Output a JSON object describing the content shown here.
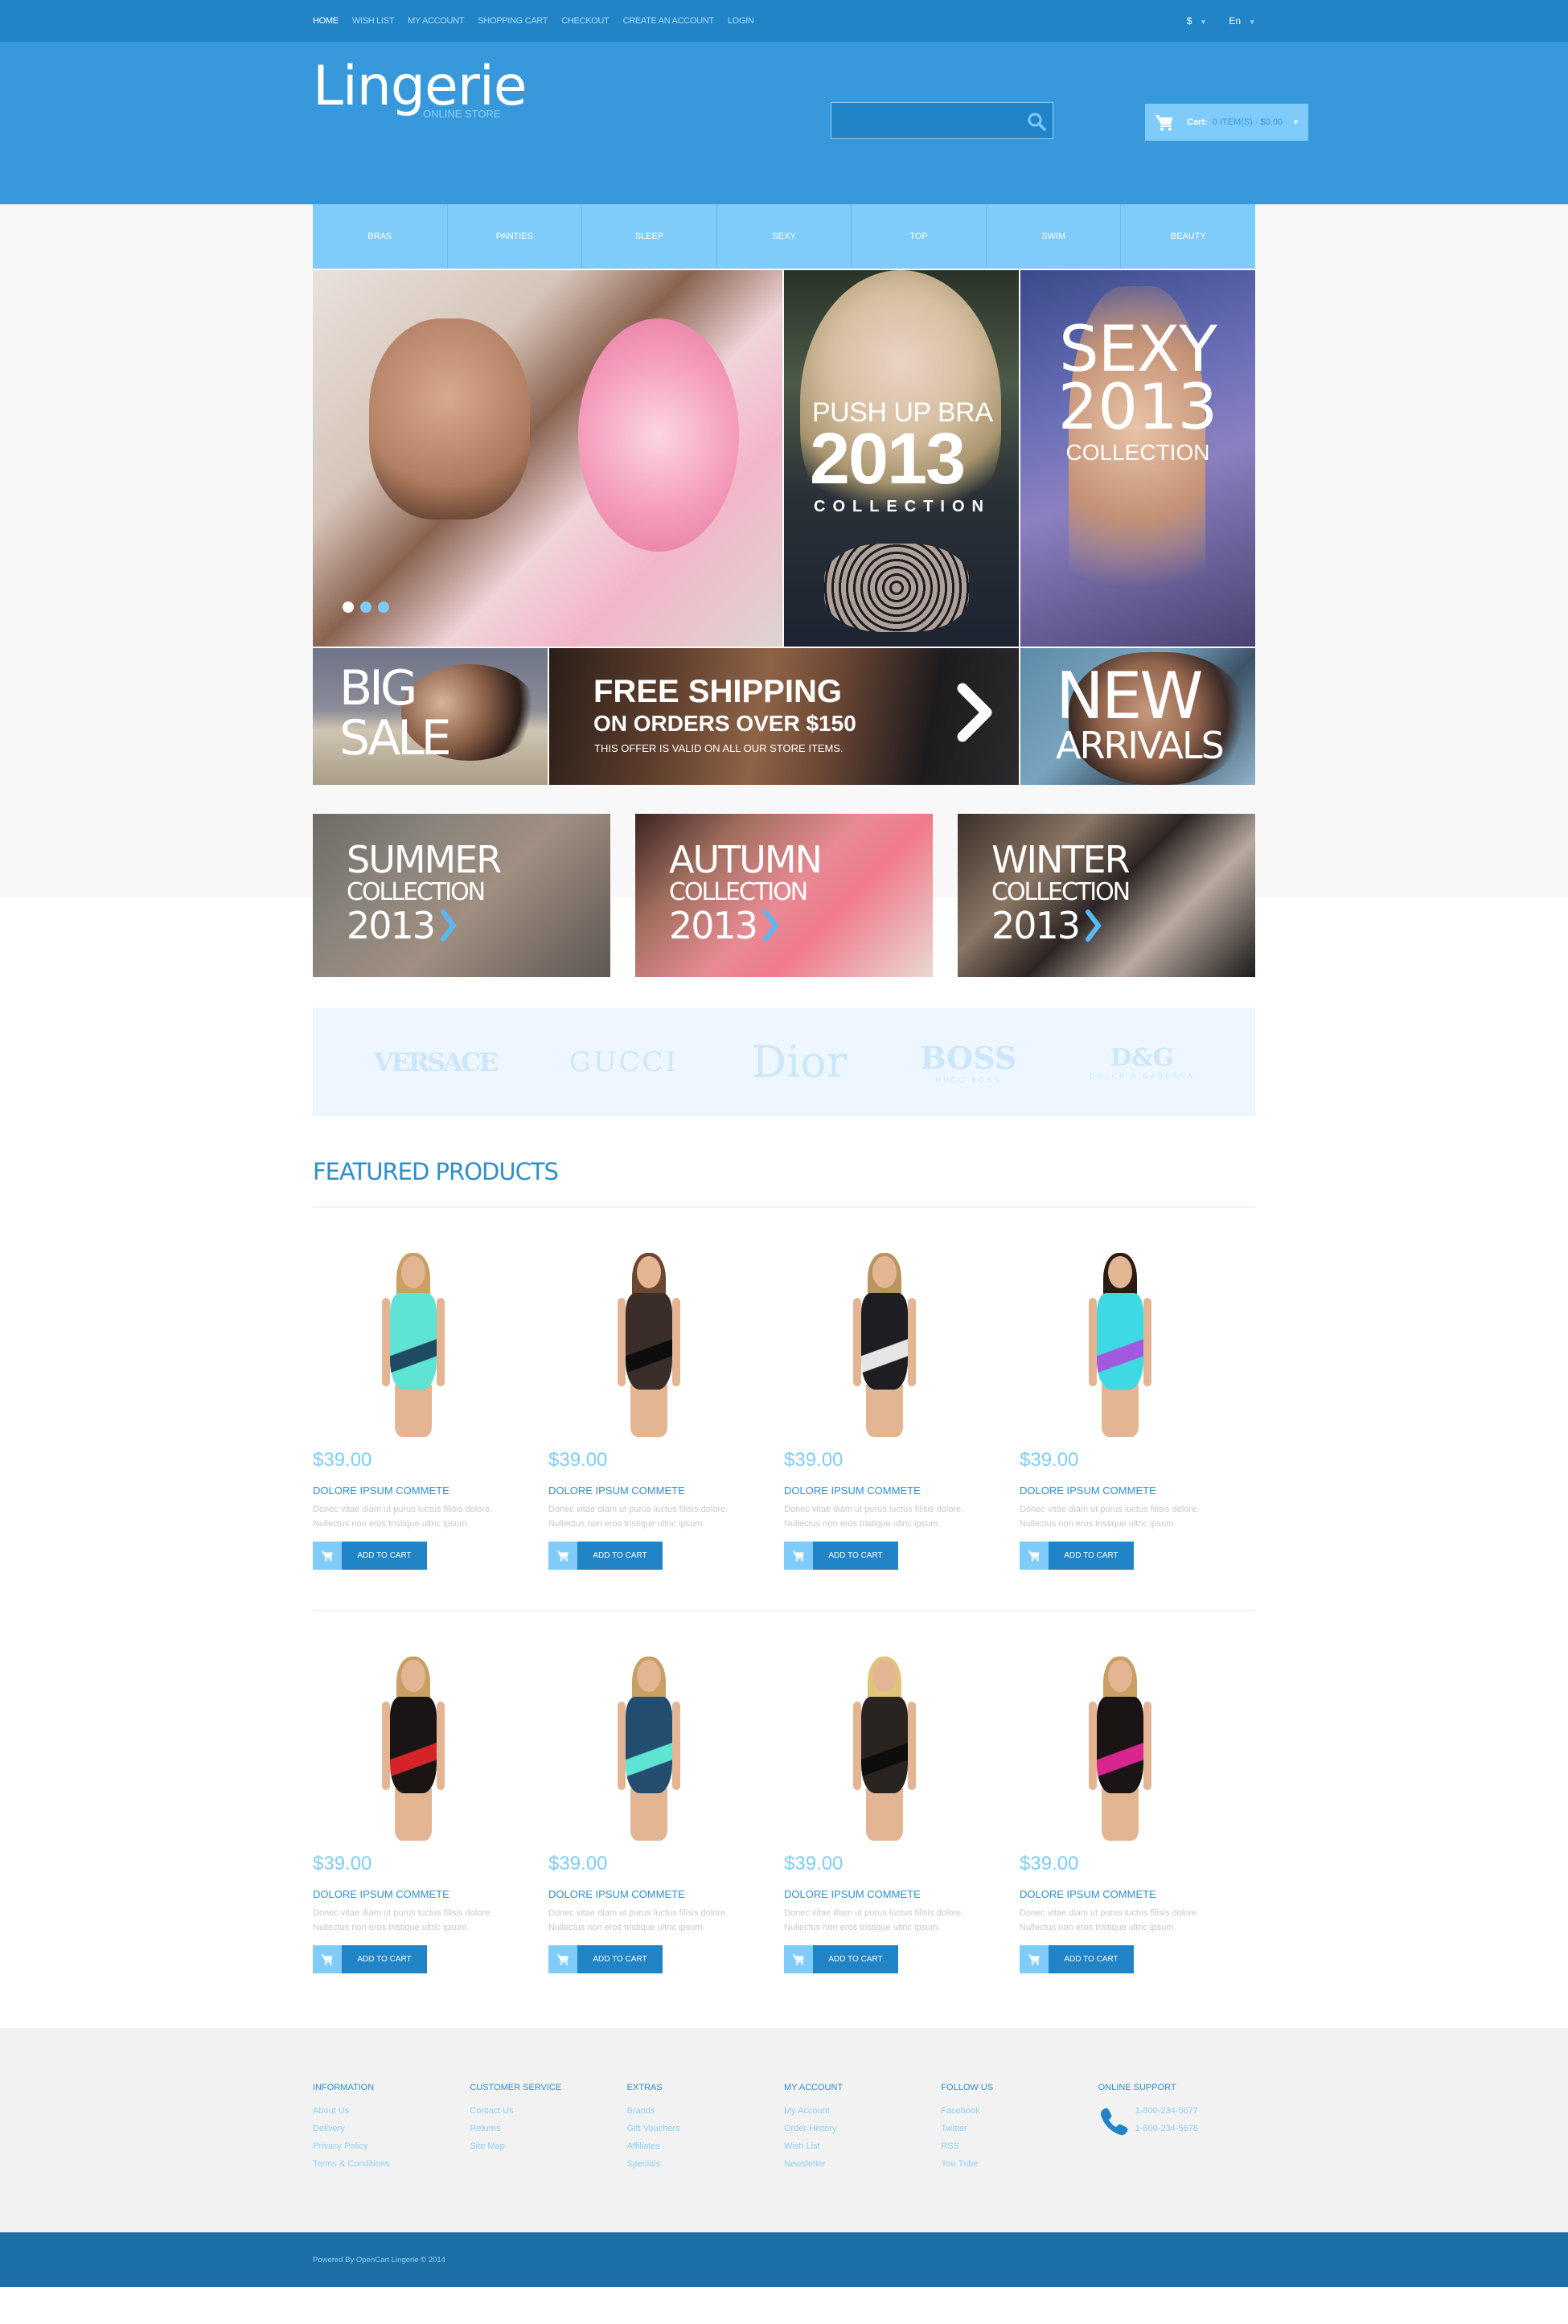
{
  "topbar": {
    "links": [
      {
        "label": "HOME",
        "active": true
      },
      {
        "label": "WISH LIST"
      },
      {
        "label": "MY ACCOUNT"
      },
      {
        "label": "SHOPPING CART"
      },
      {
        "label": "CHECKOUT"
      },
      {
        "label": "CREATE AN ACCOUNT"
      },
      {
        "label": "LOGIN"
      }
    ],
    "currency": "$",
    "language": "En"
  },
  "header": {
    "logo_name": "Lingerie",
    "logo_sub": "ONLINE STORE",
    "search_placeholder": "",
    "cart_label": "Cart:",
    "cart_value": "0 ITEM(S) - $0.00"
  },
  "menu": [
    "BRAS",
    "PANTIES",
    "SLEEP",
    "SEXY",
    "TOP",
    "SWIM",
    "BEAUTY"
  ],
  "hero": {
    "slider_dots": 3,
    "slider_active": 1,
    "pushup": {
      "line1": "PUSH UP BRA",
      "line2": "2013",
      "line3": "COLLECTION"
    },
    "sexy": {
      "line1": "SEXY",
      "line2": "2013",
      "line3": "COLLECTION"
    },
    "bigsale": {
      "line1": "BIG",
      "line2": "SALE"
    },
    "free_shipping": {
      "line1": "FREE SHIPPING",
      "line2": "ON ORDERS OVER $150",
      "line3": "THIS OFFER IS VALID ON ALL OUR STORE ITEMS."
    },
    "new_arrivals": {
      "line1": "NEW",
      "line2": "ARRIVALS"
    }
  },
  "seasons": [
    {
      "name": "SUMMER",
      "sub": "COLLECTION",
      "year": "2013"
    },
    {
      "name": "AUTUMN",
      "sub": "COLLECTION",
      "year": "2013"
    },
    {
      "name": "WINTER",
      "sub": "COLLECTION",
      "year": "2013"
    }
  ],
  "brands": [
    {
      "name": "VERSACE"
    },
    {
      "name": "GUCCI"
    },
    {
      "name": "Dior"
    },
    {
      "name": "BOSS",
      "sub": "HUGO BOSS"
    },
    {
      "name": "D&G",
      "sub": "DOLCE & GABBANA"
    }
  ],
  "featured": {
    "title": "FEATURED PRODUCTS",
    "add_to_cart": "ADD TO CART",
    "products": [
      {
        "price": "$39.00",
        "name": "DOLORE IPSUM COMMETE",
        "desc": "Donec vitae diam ut purus luctus filisis dolore. Nullectus non eros tristique ultric ipsum.",
        "color": "#5fe3d3",
        "accent": "#1f4a63",
        "hair": "#c9a064"
      },
      {
        "price": "$39.00",
        "name": "DOLORE IPSUM COMMETE",
        "desc": "Donec vitae diam ut purus luctus filisis dolore. Nullectus non eros tristique ultric ipsum.",
        "color": "#3a2d2a",
        "accent": "#0d0d0d",
        "hair": "#6b4630"
      },
      {
        "price": "$39.00",
        "name": "DOLORE IPSUM COMMETE",
        "desc": "Donec vitae diam ut purus luctus filisis dolore. Nullectus non eros tristique ultric ipsum.",
        "color": "#1d1d22",
        "accent": "#e6e6e6",
        "hair": "#b89460"
      },
      {
        "price": "$39.00",
        "name": "DOLORE IPSUM COMMETE",
        "desc": "Donec vitae diam ut purus luctus filisis dolore. Nullectus non eros tristique ultric ipsum.",
        "color": "#3fd9e3",
        "accent": "#a05ae0",
        "hair": "#2a1b14"
      },
      {
        "price": "$39.00",
        "name": "DOLORE IPSUM COMMETE",
        "desc": "Donec vitae diam ut purus luctus filisis dolore. Nullectus non eros tristique ultric ipsum.",
        "color": "#1a1414",
        "accent": "#d4242a",
        "hair": "#c8a064"
      },
      {
        "price": "$39.00",
        "name": "DOLORE IPSUM COMMETE",
        "desc": "Donec vitae diam ut purus luctus filisis dolore. Nullectus non eros tristique ultric ipsum.",
        "color": "#234d6e",
        "accent": "#5fe3d3",
        "hair": "#c8a064"
      },
      {
        "price": "$39.00",
        "name": "DOLORE IPSUM COMMETE",
        "desc": "Donec vitae diam ut purus luctus filisis dolore. Nullectus non eros tristique ultric ipsum.",
        "color": "#2a2420",
        "accent": "#0d0d0d",
        "hair": "#e0c47c"
      },
      {
        "price": "$39.00",
        "name": "DOLORE IPSUM COMMETE",
        "desc": "Donec vitae diam ut purus luctus filisis dolore. Nullectus non eros tristique ultric ipsum.",
        "color": "#1a1414",
        "accent": "#d8258f",
        "hair": "#c8a064"
      }
    ]
  },
  "footer": {
    "columns": [
      {
        "title": "INFORMATION",
        "links": [
          "About Us",
          "Delivery",
          "Privacy Policy",
          "Terms & Conditions"
        ]
      },
      {
        "title": "CUSTOMER SERVICE",
        "links": [
          "Contact Us",
          "Returns",
          "Site Map"
        ]
      },
      {
        "title": "EXTRAS",
        "links": [
          "Brands",
          "Gift Vouchers",
          "Affiliates",
          "Specials"
        ]
      },
      {
        "title": "MY ACCOUNT",
        "links": [
          "My Account",
          "Order History",
          "Wish List",
          "Newsletter"
        ]
      },
      {
        "title": "FOLLOW US",
        "links": [
          "Facebook",
          "Twitter",
          "RSS",
          "You Tube"
        ]
      }
    ],
    "support_title": "ONLINE SUPPORT",
    "phones": [
      "1-800-234-5677",
      "1-800-234-5678"
    ],
    "copyright": "Powered By OpenCart Lingerie © 2014"
  },
  "colors": {
    "topbar": "#2184c7",
    "header": "#3799dc",
    "accent_light": "#7fccfb",
    "footer_bottom": "#1d6fa8"
  }
}
